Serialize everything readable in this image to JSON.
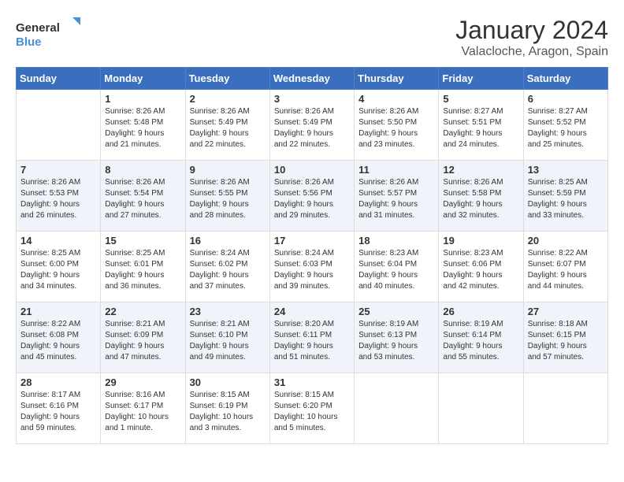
{
  "logo": {
    "general": "General",
    "blue": "Blue"
  },
  "title": "January 2024",
  "location": "Valacloche, Aragon, Spain",
  "days_of_week": [
    "Sunday",
    "Monday",
    "Tuesday",
    "Wednesday",
    "Thursday",
    "Friday",
    "Saturday"
  ],
  "weeks": [
    [
      {
        "day": "",
        "content": ""
      },
      {
        "day": "1",
        "content": "Sunrise: 8:26 AM\nSunset: 5:48 PM\nDaylight: 9 hours\nand 21 minutes."
      },
      {
        "day": "2",
        "content": "Sunrise: 8:26 AM\nSunset: 5:49 PM\nDaylight: 9 hours\nand 22 minutes."
      },
      {
        "day": "3",
        "content": "Sunrise: 8:26 AM\nSunset: 5:49 PM\nDaylight: 9 hours\nand 22 minutes."
      },
      {
        "day": "4",
        "content": "Sunrise: 8:26 AM\nSunset: 5:50 PM\nDaylight: 9 hours\nand 23 minutes."
      },
      {
        "day": "5",
        "content": "Sunrise: 8:27 AM\nSunset: 5:51 PM\nDaylight: 9 hours\nand 24 minutes."
      },
      {
        "day": "6",
        "content": "Sunrise: 8:27 AM\nSunset: 5:52 PM\nDaylight: 9 hours\nand 25 minutes."
      }
    ],
    [
      {
        "day": "7",
        "content": "Sunrise: 8:26 AM\nSunset: 5:53 PM\nDaylight: 9 hours\nand 26 minutes."
      },
      {
        "day": "8",
        "content": "Sunrise: 8:26 AM\nSunset: 5:54 PM\nDaylight: 9 hours\nand 27 minutes."
      },
      {
        "day": "9",
        "content": "Sunrise: 8:26 AM\nSunset: 5:55 PM\nDaylight: 9 hours\nand 28 minutes."
      },
      {
        "day": "10",
        "content": "Sunrise: 8:26 AM\nSunset: 5:56 PM\nDaylight: 9 hours\nand 29 minutes."
      },
      {
        "day": "11",
        "content": "Sunrise: 8:26 AM\nSunset: 5:57 PM\nDaylight: 9 hours\nand 31 minutes."
      },
      {
        "day": "12",
        "content": "Sunrise: 8:26 AM\nSunset: 5:58 PM\nDaylight: 9 hours\nand 32 minutes."
      },
      {
        "day": "13",
        "content": "Sunrise: 8:25 AM\nSunset: 5:59 PM\nDaylight: 9 hours\nand 33 minutes."
      }
    ],
    [
      {
        "day": "14",
        "content": "Sunrise: 8:25 AM\nSunset: 6:00 PM\nDaylight: 9 hours\nand 34 minutes."
      },
      {
        "day": "15",
        "content": "Sunrise: 8:25 AM\nSunset: 6:01 PM\nDaylight: 9 hours\nand 36 minutes."
      },
      {
        "day": "16",
        "content": "Sunrise: 8:24 AM\nSunset: 6:02 PM\nDaylight: 9 hours\nand 37 minutes."
      },
      {
        "day": "17",
        "content": "Sunrise: 8:24 AM\nSunset: 6:03 PM\nDaylight: 9 hours\nand 39 minutes."
      },
      {
        "day": "18",
        "content": "Sunrise: 8:23 AM\nSunset: 6:04 PM\nDaylight: 9 hours\nand 40 minutes."
      },
      {
        "day": "19",
        "content": "Sunrise: 8:23 AM\nSunset: 6:06 PM\nDaylight: 9 hours\nand 42 minutes."
      },
      {
        "day": "20",
        "content": "Sunrise: 8:22 AM\nSunset: 6:07 PM\nDaylight: 9 hours\nand 44 minutes."
      }
    ],
    [
      {
        "day": "21",
        "content": "Sunrise: 8:22 AM\nSunset: 6:08 PM\nDaylight: 9 hours\nand 45 minutes."
      },
      {
        "day": "22",
        "content": "Sunrise: 8:21 AM\nSunset: 6:09 PM\nDaylight: 9 hours\nand 47 minutes."
      },
      {
        "day": "23",
        "content": "Sunrise: 8:21 AM\nSunset: 6:10 PM\nDaylight: 9 hours\nand 49 minutes."
      },
      {
        "day": "24",
        "content": "Sunrise: 8:20 AM\nSunset: 6:11 PM\nDaylight: 9 hours\nand 51 minutes."
      },
      {
        "day": "25",
        "content": "Sunrise: 8:19 AM\nSunset: 6:13 PM\nDaylight: 9 hours\nand 53 minutes."
      },
      {
        "day": "26",
        "content": "Sunrise: 8:19 AM\nSunset: 6:14 PM\nDaylight: 9 hours\nand 55 minutes."
      },
      {
        "day": "27",
        "content": "Sunrise: 8:18 AM\nSunset: 6:15 PM\nDaylight: 9 hours\nand 57 minutes."
      }
    ],
    [
      {
        "day": "28",
        "content": "Sunrise: 8:17 AM\nSunset: 6:16 PM\nDaylight: 9 hours\nand 59 minutes."
      },
      {
        "day": "29",
        "content": "Sunrise: 8:16 AM\nSunset: 6:17 PM\nDaylight: 10 hours\nand 1 minute."
      },
      {
        "day": "30",
        "content": "Sunrise: 8:15 AM\nSunset: 6:19 PM\nDaylight: 10 hours\nand 3 minutes."
      },
      {
        "day": "31",
        "content": "Sunrise: 8:15 AM\nSunset: 6:20 PM\nDaylight: 10 hours\nand 5 minutes."
      },
      {
        "day": "",
        "content": ""
      },
      {
        "day": "",
        "content": ""
      },
      {
        "day": "",
        "content": ""
      }
    ]
  ]
}
